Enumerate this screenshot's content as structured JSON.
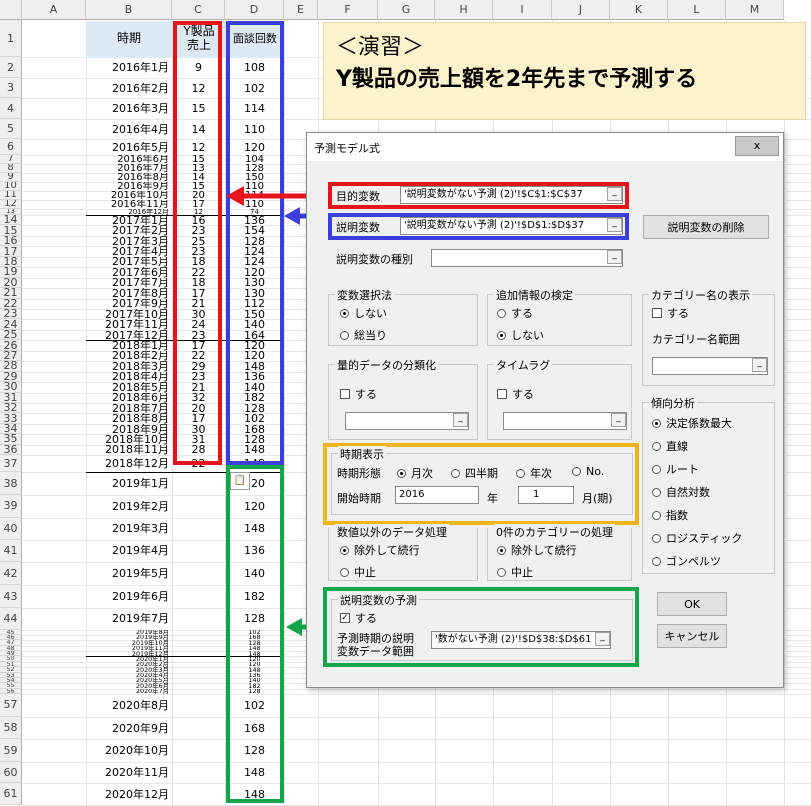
{
  "columns": [
    "A",
    "B",
    "C",
    "D",
    "E",
    "F",
    "G",
    "H",
    "I",
    "J",
    "K",
    "L",
    "M"
  ],
  "rows": [
    {
      "n": "1",
      "b": "",
      "c": "",
      "d": ""
    },
    {
      "n": "2",
      "b": "2016年1月",
      "c": "9",
      "d": "108"
    },
    {
      "n": "3",
      "b": "2016年2月",
      "c": "12",
      "d": "102"
    },
    {
      "n": "4",
      "b": "2016年3月",
      "c": "15",
      "d": "114"
    },
    {
      "n": "5",
      "b": "2016年4月",
      "c": "14",
      "d": "110"
    },
    {
      "n": "6",
      "b": "2016年5月",
      "c": "12",
      "d": "120"
    },
    {
      "n": "7",
      "b": "2016年6月",
      "c": "15",
      "d": "104"
    },
    {
      "n": "8",
      "b": "2016年7月",
      "c": "13",
      "d": "128"
    },
    {
      "n": "9",
      "b": "2016年8月",
      "c": "14",
      "d": "150"
    },
    {
      "n": "10",
      "b": "2016年9月",
      "c": "15",
      "d": "110"
    },
    {
      "n": "11",
      "b": "2016年10月",
      "c": "20",
      "d": "114"
    },
    {
      "n": "12",
      "b": "2016年11月",
      "c": "17",
      "d": "110"
    },
    {
      "n": "13",
      "b": "2016年12月",
      "c": "12",
      "d": "74"
    },
    {
      "n": "14",
      "b": "2017年1月",
      "c": "16",
      "d": "136"
    },
    {
      "n": "15",
      "b": "2017年2月",
      "c": "23",
      "d": "154"
    },
    {
      "n": "16",
      "b": "2017年3月",
      "c": "25",
      "d": "128"
    },
    {
      "n": "17",
      "b": "2017年4月",
      "c": "23",
      "d": "124"
    },
    {
      "n": "18",
      "b": "2017年5月",
      "c": "18",
      "d": "124"
    },
    {
      "n": "19",
      "b": "2017年6月",
      "c": "22",
      "d": "120"
    },
    {
      "n": "20",
      "b": "2017年7月",
      "c": "18",
      "d": "130"
    },
    {
      "n": "21",
      "b": "2017年8月",
      "c": "17",
      "d": "130"
    },
    {
      "n": "22",
      "b": "2017年9月",
      "c": "21",
      "d": "112"
    },
    {
      "n": "23",
      "b": "2017年10月",
      "c": "30",
      "d": "150"
    },
    {
      "n": "24",
      "b": "2017年11月",
      "c": "24",
      "d": "140"
    },
    {
      "n": "25",
      "b": "2017年12月",
      "c": "23",
      "d": "164"
    },
    {
      "n": "26",
      "b": "2018年1月",
      "c": "17",
      "d": "120"
    },
    {
      "n": "27",
      "b": "2018年2月",
      "c": "22",
      "d": "120"
    },
    {
      "n": "28",
      "b": "2018年3月",
      "c": "29",
      "d": "148"
    },
    {
      "n": "29",
      "b": "2018年4月",
      "c": "23",
      "d": "136"
    },
    {
      "n": "30",
      "b": "2018年5月",
      "c": "21",
      "d": "140"
    },
    {
      "n": "31",
      "b": "2018年6月",
      "c": "32",
      "d": "182"
    },
    {
      "n": "32",
      "b": "2018年7月",
      "c": "20",
      "d": "128"
    },
    {
      "n": "33",
      "b": "2018年8月",
      "c": "17",
      "d": "102"
    },
    {
      "n": "34",
      "b": "2018年9月",
      "c": "30",
      "d": "168"
    },
    {
      "n": "35",
      "b": "2018年10月",
      "c": "31",
      "d": "128"
    },
    {
      "n": "36",
      "b": "2018年11月",
      "c": "28",
      "d": "148"
    },
    {
      "n": "37",
      "b": "2018年12月",
      "c": "22",
      "d": "148"
    },
    {
      "n": "38",
      "b": "2019年1月",
      "c": "",
      "d": "120"
    },
    {
      "n": "39",
      "b": "2019年2月",
      "c": "",
      "d": "120"
    },
    {
      "n": "40",
      "b": "2019年3月",
      "c": "",
      "d": "148"
    },
    {
      "n": "41",
      "b": "2019年4月",
      "c": "",
      "d": "136"
    },
    {
      "n": "42",
      "b": "2019年5月",
      "c": "",
      "d": "140"
    },
    {
      "n": "43",
      "b": "2019年6月",
      "c": "",
      "d": "182"
    },
    {
      "n": "44",
      "b": "2019年7月",
      "c": "",
      "d": "128"
    },
    {
      "n": "45",
      "b": "2019年8月",
      "c": "",
      "d": "102"
    },
    {
      "n": "46",
      "b": "2019年9月",
      "c": "",
      "d": "168"
    },
    {
      "n": "47",
      "b": "2019年10月",
      "c": "",
      "d": "128"
    },
    {
      "n": "48",
      "b": "2019年11月",
      "c": "",
      "d": "148"
    },
    {
      "n": "49",
      "b": "2019年12月",
      "c": "",
      "d": "148"
    },
    {
      "n": "50",
      "b": "2020年1月",
      "c": "",
      "d": "120"
    },
    {
      "n": "51",
      "b": "2020年2月",
      "c": "",
      "d": "120"
    },
    {
      "n": "52",
      "b": "2020年3月",
      "c": "",
      "d": "148"
    },
    {
      "n": "53",
      "b": "2020年4月",
      "c": "",
      "d": "136"
    },
    {
      "n": "54",
      "b": "2020年5月",
      "c": "",
      "d": "140"
    },
    {
      "n": "55",
      "b": "2020年6月",
      "c": "",
      "d": "182"
    },
    {
      "n": "56",
      "b": "2020年7月",
      "c": "",
      "d": "128"
    },
    {
      "n": "57",
      "b": "2020年8月",
      "c": "",
      "d": "102"
    },
    {
      "n": "58",
      "b": "2020年9月",
      "c": "",
      "d": "168"
    },
    {
      "n": "59",
      "b": "2020年10月",
      "c": "",
      "d": "128"
    },
    {
      "n": "60",
      "b": "2020年11月",
      "c": "",
      "d": "148"
    },
    {
      "n": "61",
      "b": "2020年12月",
      "c": "",
      "d": "148"
    }
  ],
  "headers": {
    "b": "時期",
    "c": "Y製品\n売上",
    "d": "面談回数"
  },
  "callout": {
    "line1": "＜演習＞",
    "line2": "Y製品の売上額を2年先まで予測する"
  },
  "colors": {
    "red": "#e8141c",
    "blue": "#3b3fe0",
    "green": "#12a64a",
    "orange": "#f4b41a",
    "header_fill": "#dde9f5",
    "callout_fill": "#fef2cc"
  },
  "dialog": {
    "title": "予測モデル式",
    "close": "x",
    "objective_label": "目的変数",
    "objective_value": "'説明変数がない予測 (2)'!$C$1:$C$37",
    "explanatory_label": "説明変数",
    "explanatory_value": "'説明変数がない予測 (2)'!$D$1:$D$37",
    "delete_button": "説明変数の削除",
    "type_label": "説明変数の種別",
    "type_value": "",
    "var_select": {
      "title": "変数選択法",
      "opt1": "しない",
      "opt2": "総当り"
    },
    "extra_test": {
      "title": "追加情報の検定",
      "opt1": "する",
      "opt2": "しない"
    },
    "category_display": {
      "title": "カテゴリー名の表示",
      "check": "する",
      "range_label": "カテゴリー名範囲",
      "range_value": ""
    },
    "quant_class": {
      "title": "量的データの分類化",
      "check": "する",
      "value": ""
    },
    "timelag": {
      "title": "タイムラグ",
      "check": "する",
      "value": ""
    },
    "trend": {
      "title": "傾向分析",
      "options": [
        "決定係数最大",
        "直線",
        "ルート",
        "自然対数",
        "指数",
        "ロジスティック",
        "ゴンペルツ"
      ]
    },
    "period": {
      "title": "時期表示",
      "format_label": "時期形態",
      "opt_monthly": "月次",
      "opt_quarter": "四半期",
      "opt_year": "年次",
      "opt_no": "No.",
      "start_label": "開始時期",
      "start_year": "2016",
      "year_unit": "年",
      "start_month": "1",
      "month_unit": "月(期)"
    },
    "nonnumeric": {
      "title": "数値以外のデータ処理",
      "opt1": "除外して続行",
      "opt2": "中止"
    },
    "zero_cat": {
      "title": "0件のカテゴリーの処理",
      "opt1": "除外して続行",
      "opt2": "中止"
    },
    "forecast": {
      "title": "説明変数の予測",
      "check": "する",
      "range_label1": "予測時期の説明",
      "range_label2": "変数データ範囲",
      "range_value": "'数がない予測 (2)'!$D$38:$D$61"
    },
    "ok": "OK",
    "cancel": "キャンセル"
  }
}
